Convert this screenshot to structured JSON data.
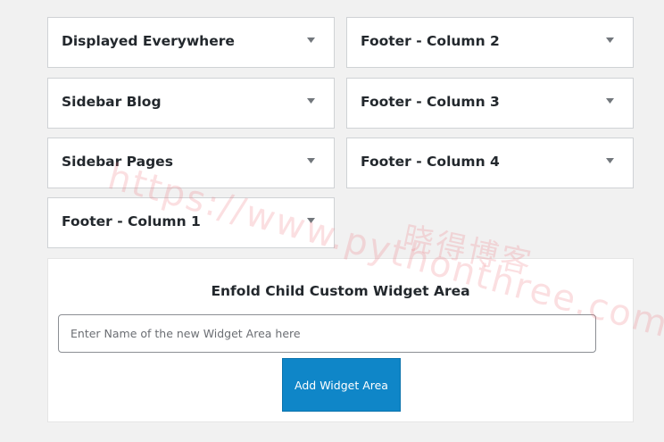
{
  "widget_areas": [
    {
      "title": "Displayed Everywhere"
    },
    {
      "title": "Footer - Column 2"
    },
    {
      "title": "Sidebar Blog"
    },
    {
      "title": "Footer - Column 3"
    },
    {
      "title": "Sidebar Pages"
    },
    {
      "title": "Footer - Column 4"
    },
    {
      "title": "Footer - Column 1"
    }
  ],
  "custom_widget_area": {
    "heading": "Enfold Child Custom Widget Area",
    "input_placeholder": "Enter Name of the new Widget Area here",
    "input_value": "",
    "button_label": "Add Widget Area"
  },
  "watermark": {
    "url_text": "https://www.pythonthree.com",
    "cn_text": "晓得博客"
  },
  "colors": {
    "button_bg": "#0f86c8",
    "background": "#f1f1f1",
    "panel": "#ffffff"
  }
}
